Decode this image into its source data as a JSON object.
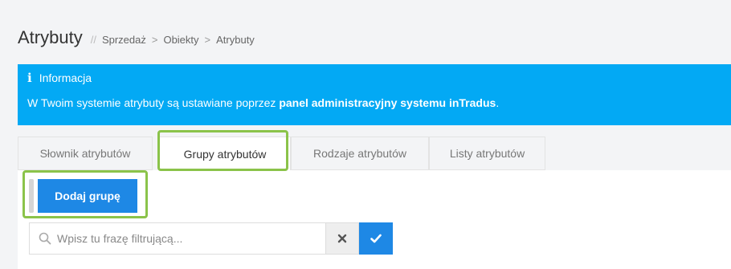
{
  "header": {
    "title": "Atrybuty",
    "separator": "//",
    "breadcrumb": [
      "Sprzedaż",
      "Obiekty",
      "Atrybuty"
    ],
    "breadcrumb_arrow": ">"
  },
  "info": {
    "icon": "info-icon",
    "heading": "Informacja",
    "text_prefix": "W Twoim systemie atrybuty są ustawiane poprzez ",
    "text_bold": "panel administracyjny systemu inTradus",
    "text_suffix": ".",
    "bg_color": "#03a9f4"
  },
  "tabs": [
    {
      "label": "Słownik atrybutów",
      "active": false
    },
    {
      "label": "Grupy atrybutów",
      "active": true
    },
    {
      "label": "Rodzaje atrybutów",
      "active": false
    },
    {
      "label": "Listy atrybutów",
      "active": false
    }
  ],
  "actions": {
    "add_group_label": "Dodaj grupę"
  },
  "filter": {
    "placeholder": "Wpisz tu frazę filtrującą...",
    "value": "",
    "clear_icon": "close-icon",
    "apply_icon": "check-icon"
  },
  "colors": {
    "accent": "#1e88e5",
    "highlight": "#8bc34a"
  }
}
